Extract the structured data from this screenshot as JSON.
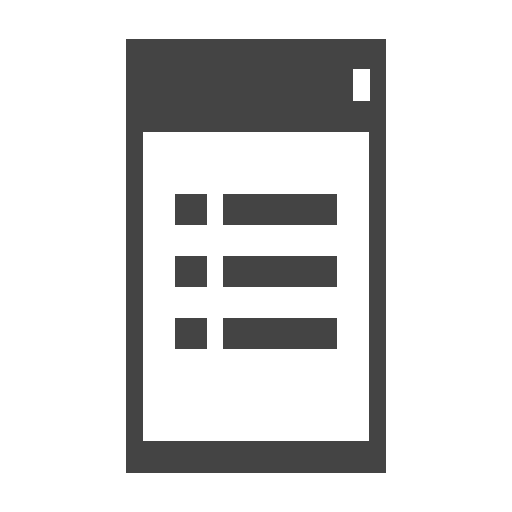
{
  "icon": {
    "name": "mobile-list-icon",
    "colors": {
      "foreground": "#444444",
      "background": "#ffffff"
    },
    "list": {
      "row_count": 3
    }
  }
}
